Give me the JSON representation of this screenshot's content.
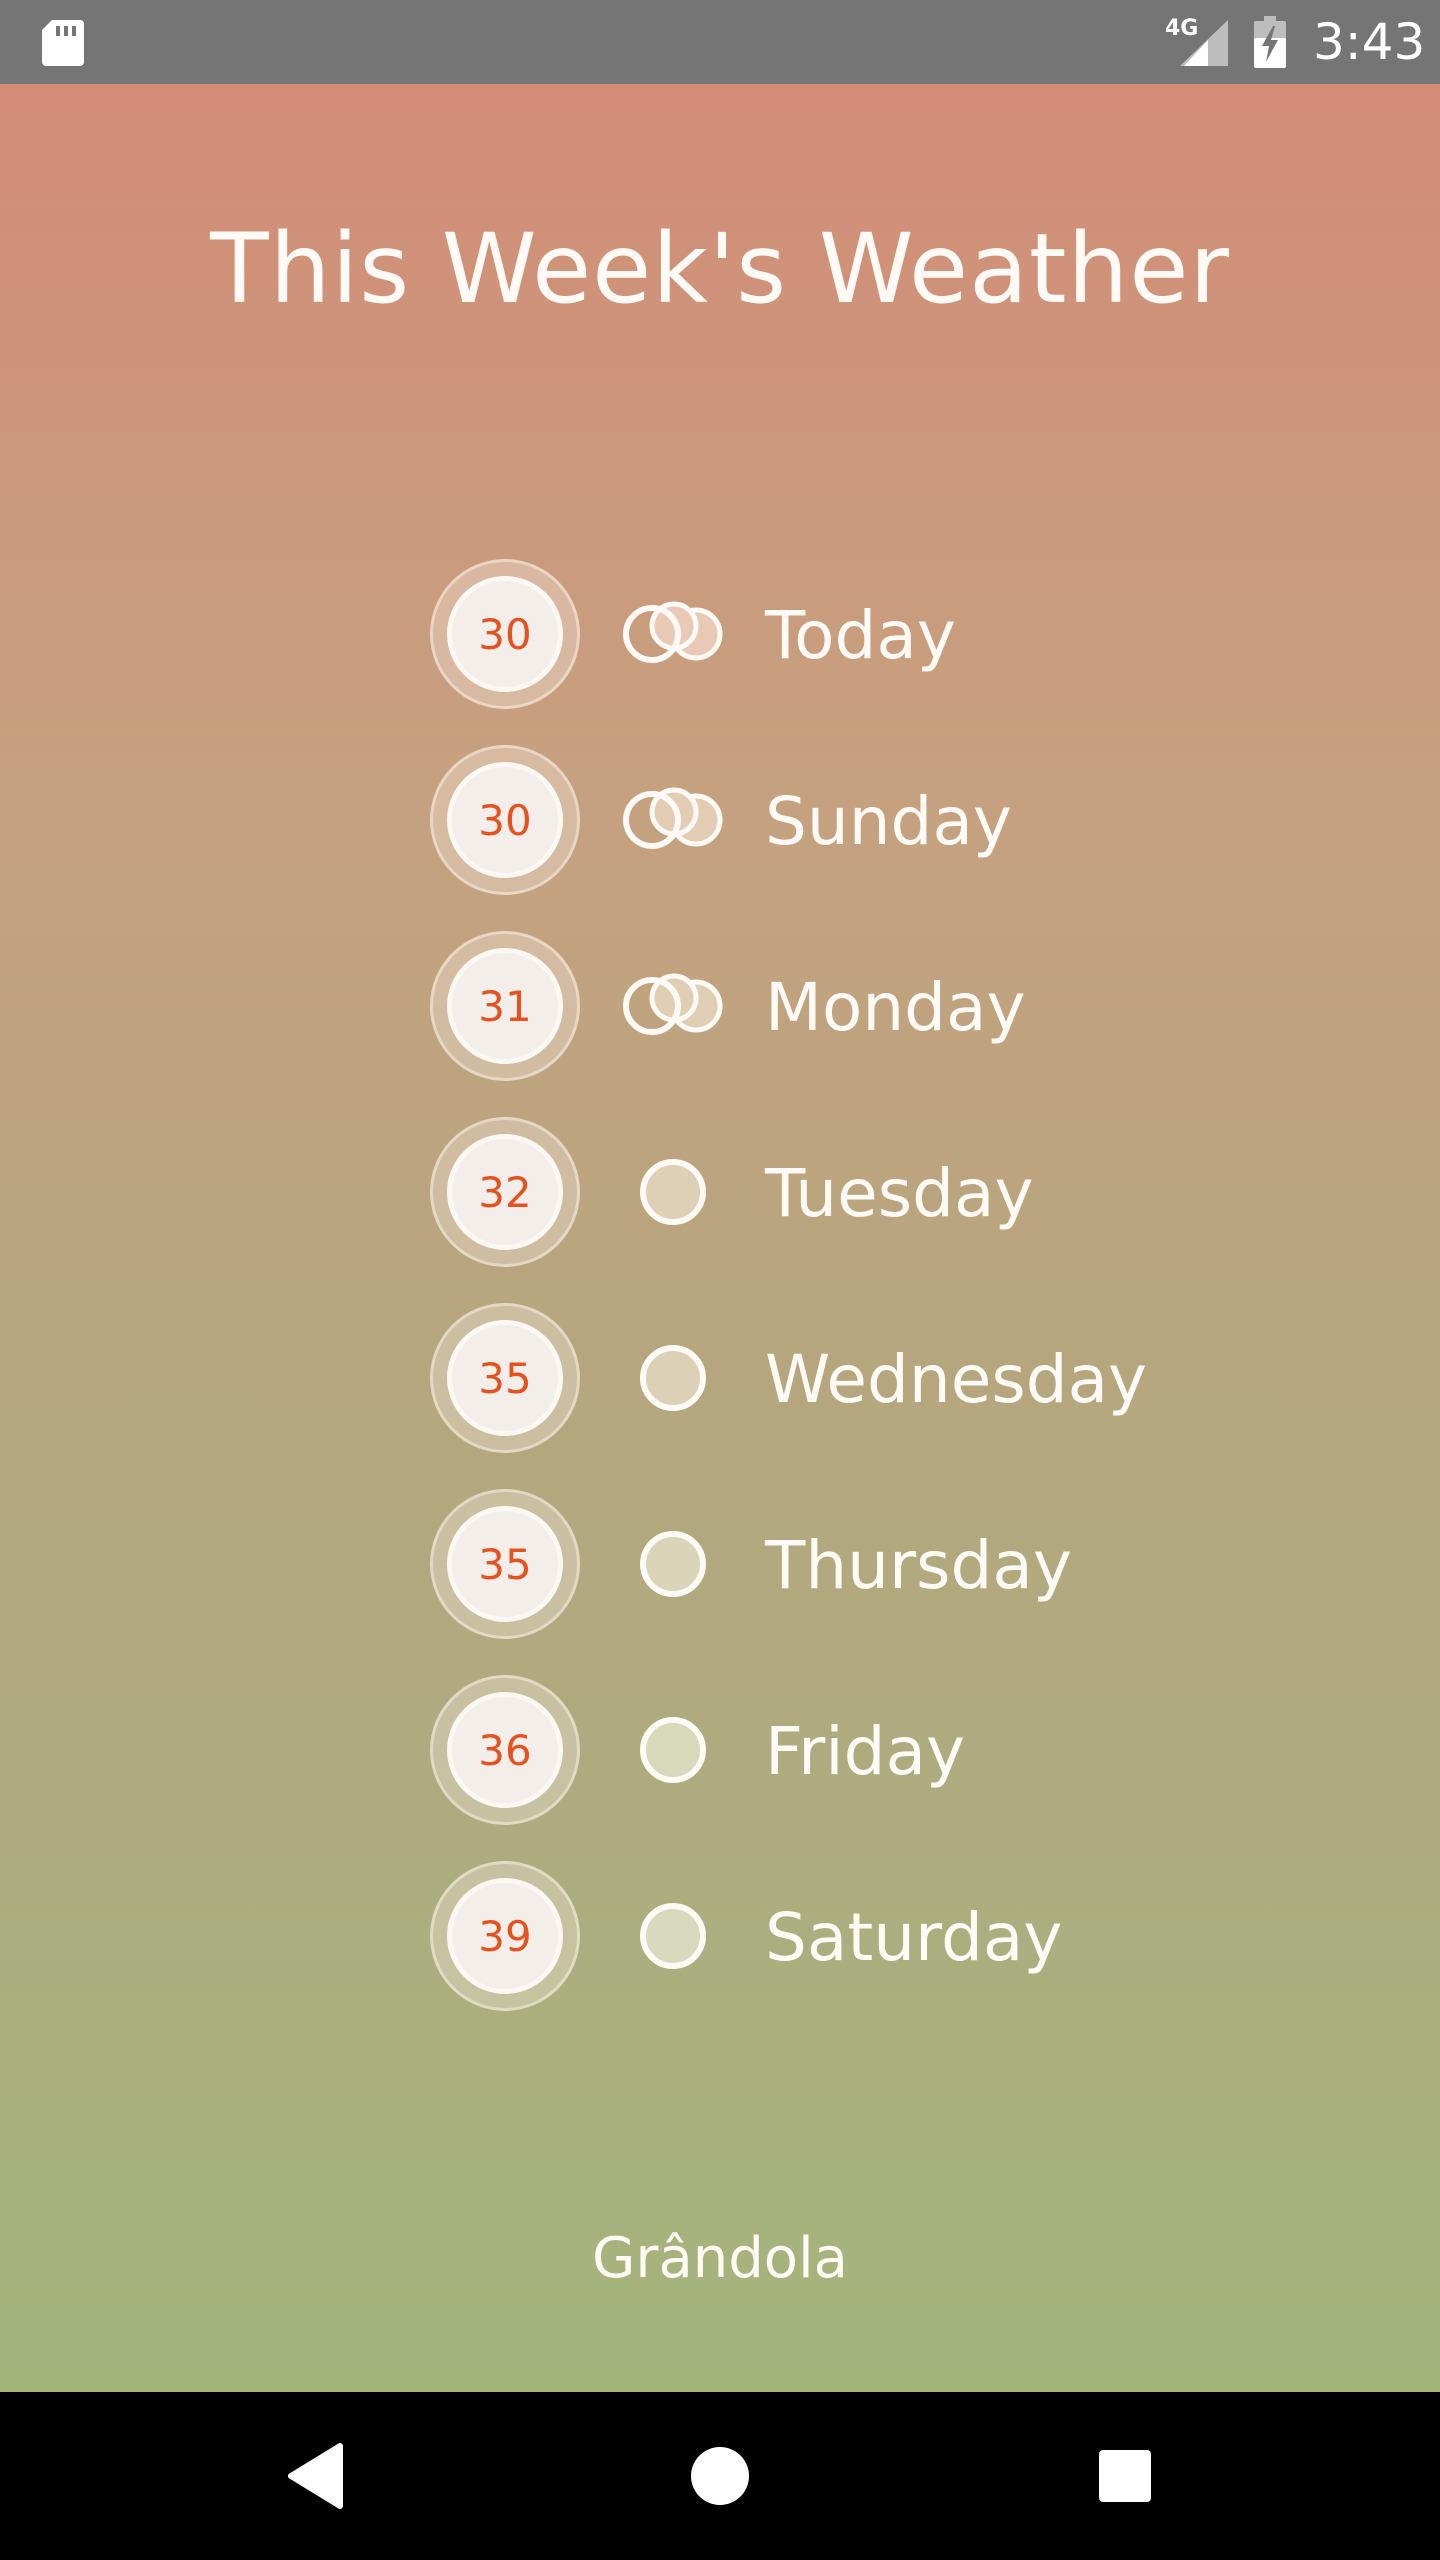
{
  "status_bar": {
    "network_type": "4G",
    "time": "3:43",
    "icons": [
      "sd-card-icon",
      "cell-signal-icon",
      "battery-charging-icon"
    ]
  },
  "page": {
    "title": "This Week's Weather",
    "location": "Grândola"
  },
  "days": [
    {
      "label": "Today",
      "temp": "30",
      "icon": "cloud-icon"
    },
    {
      "label": "Sunday",
      "temp": "30",
      "icon": "cloud-icon"
    },
    {
      "label": "Monday",
      "temp": "31",
      "icon": "cloud-icon"
    },
    {
      "label": "Tuesday",
      "temp": "32",
      "icon": "sun-icon"
    },
    {
      "label": "Wednesday",
      "temp": "35",
      "icon": "sun-icon"
    },
    {
      "label": "Thursday",
      "temp": "35",
      "icon": "sun-icon"
    },
    {
      "label": "Friday",
      "temp": "36",
      "icon": "sun-icon"
    },
    {
      "label": "Saturday",
      "temp": "39",
      "icon": "sun-icon"
    }
  ],
  "colors": {
    "temp_text": "#e5521f",
    "gradient_top": "#d38c77",
    "gradient_bottom": "#a4b57c"
  },
  "nav_bar": {
    "icons": [
      "back-icon",
      "home-icon",
      "recent-apps-icon"
    ]
  }
}
